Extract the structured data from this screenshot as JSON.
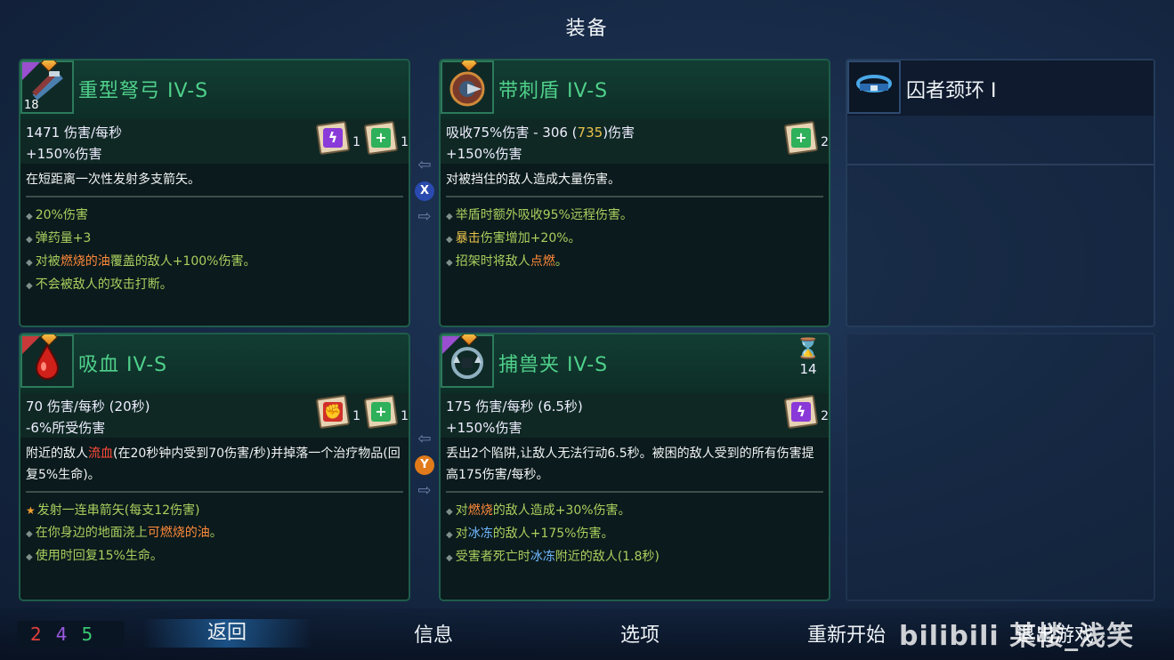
{
  "screen_title": "装备",
  "cards": [
    {
      "name": "重型弩弓 IV-S",
      "level": "18",
      "stat1": "1471 伤害/每秒",
      "stat2": "+150%伤害",
      "scrolls": [
        {
          "type": "purple",
          "count": "1"
        },
        {
          "type": "green",
          "count": "1"
        }
      ],
      "desc": "在短距离一次性发射多支箭矢。",
      "perks": [
        {
          "segs": [
            {
              "t": "20%伤害",
              "c": ""
            }
          ]
        },
        {
          "segs": [
            {
              "t": "弹药量+3",
              "c": ""
            }
          ]
        },
        {
          "segs": [
            {
              "t": "对被",
              "c": ""
            },
            {
              "t": "燃烧的油",
              "c": "fire"
            },
            {
              "t": "覆盖的敌人+100%伤害。",
              "c": ""
            }
          ]
        },
        {
          "segs": [
            {
              "t": "不会被敌人的攻击打断。",
              "c": ""
            }
          ]
        }
      ]
    },
    {
      "name": "带刺盾 IV-S",
      "stat1_pre": "吸收75%伤害 - 306 (",
      "stat1_gold": "735",
      "stat1_post": ")伤害",
      "stat2": "+150%伤害",
      "scrolls": [
        {
          "type": "green",
          "count": "2"
        }
      ],
      "desc": "对被挡住的敌人造成大量伤害。",
      "perks": [
        {
          "segs": [
            {
              "t": "举盾时额外吸收95%远程伤害。",
              "c": ""
            }
          ]
        },
        {
          "segs": [
            {
              "t": "暴击",
              "c": "gold"
            },
            {
              "t": "伤害增加+20%。",
              "c": ""
            }
          ]
        },
        {
          "segs": [
            {
              "t": "招架时将敌人",
              "c": ""
            },
            {
              "t": "点燃",
              "c": "fire"
            },
            {
              "t": "。",
              "c": ""
            }
          ]
        }
      ]
    },
    {
      "name": "吸血 IV-S",
      "stat1": "70 伤害/每秒 (20秒)",
      "stat2": "-6%所受伤害",
      "scrolls": [
        {
          "type": "red",
          "count": "1"
        },
        {
          "type": "green",
          "count": "1"
        }
      ],
      "desc_segs": [
        {
          "t": "附近的敌人",
          "c": ""
        },
        {
          "t": "流血",
          "c": "red"
        },
        {
          "t": "(在20秒钟内受到70伤害/秒)并掉落一个治疗物品(回复5%生命)。",
          "c": ""
        }
      ],
      "perks": [
        {
          "star": true,
          "segs": [
            {
              "t": "发射一连串箭矢(每支12伤害)",
              "c": ""
            }
          ]
        },
        {
          "segs": [
            {
              "t": "在你身边的地面浇上",
              "c": ""
            },
            {
              "t": "可燃烧的油",
              "c": "fire"
            },
            {
              "t": "。",
              "c": ""
            }
          ]
        },
        {
          "segs": [
            {
              "t": "使用时回复15%生命。",
              "c": ""
            }
          ]
        }
      ]
    },
    {
      "name": "捕兽夹 IV-S",
      "cooldown": "14",
      "stat1": "175 伤害/每秒 (6.5秒)",
      "stat2": "+150%伤害",
      "scrolls": [
        {
          "type": "purple",
          "count": "2"
        }
      ],
      "desc": "丢出2个陷阱,让敌人无法行动6.5秒。被困的敌人受到的所有伤害提高175伤害/每秒。",
      "perks": [
        {
          "segs": [
            {
              "t": "对",
              "c": ""
            },
            {
              "t": "燃烧",
              "c": "fire"
            },
            {
              "t": "的敌人造成+30%伤害。",
              "c": ""
            }
          ]
        },
        {
          "segs": [
            {
              "t": "对",
              "c": ""
            },
            {
              "t": "冰冻",
              "c": "ice"
            },
            {
              "t": "的敌人+175%伤害。",
              "c": ""
            }
          ]
        },
        {
          "segs": [
            {
              "t": "受害者死亡时",
              "c": ""
            },
            {
              "t": "冰冻",
              "c": "ice"
            },
            {
              "t": "附近的敌人(1.8秒)",
              "c": ""
            }
          ]
        }
      ]
    }
  ],
  "amulet": {
    "name": "囚者颈环 I"
  },
  "swap_keys": [
    "X",
    "Y"
  ],
  "counters": [
    {
      "value": "2",
      "color": "#e0403a"
    },
    {
      "value": "4",
      "color": "#9a5ae0"
    },
    {
      "value": "5",
      "color": "#3ac870"
    }
  ],
  "menu": {
    "back": "返回",
    "info": "信息",
    "options": "选项",
    "restart": "重新开始",
    "quit": "退出游戏"
  },
  "watermark": "bilibili 某楼_浅笑",
  "icons": {
    "weapon1": "crossbow-icon",
    "weapon2": "spiked-shield-icon",
    "skill1": "blood-drop-icon",
    "skill2": "beartrap-icon",
    "amulet": "collar-icon"
  }
}
